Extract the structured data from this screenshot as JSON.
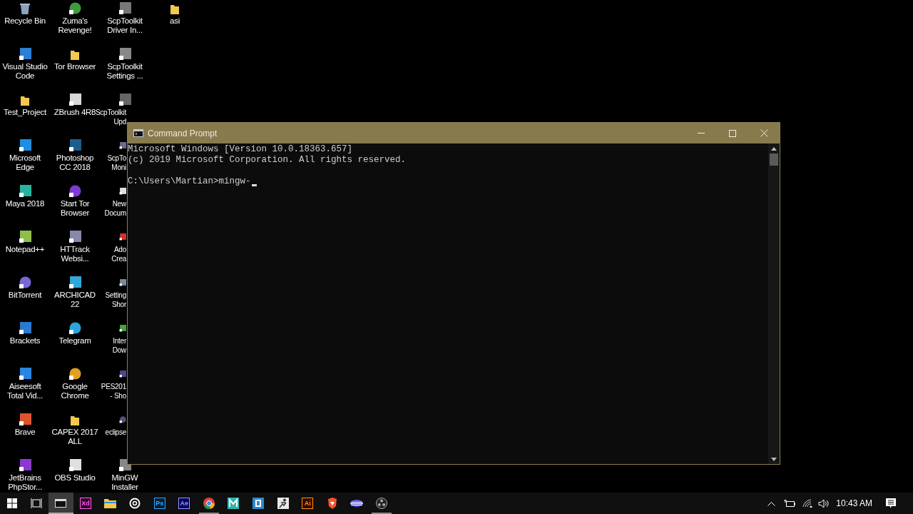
{
  "desktop": {
    "columns": [
      {
        "icons": [
          {
            "label": "Recycle Bin"
          },
          {
            "label": "Visual Studio Code"
          },
          {
            "label": "Test_Project"
          },
          {
            "label": "Microsoft Edge"
          },
          {
            "label": "Maya 2018"
          },
          {
            "label": "Notepad++"
          },
          {
            "label": "BitTorrent"
          },
          {
            "label": "Brackets"
          },
          {
            "label": "Aiseesoft Total Vid..."
          },
          {
            "label": "Brave"
          },
          {
            "label": "JetBrains PhpStor..."
          }
        ]
      },
      {
        "icons": [
          {
            "label": "Zuma's Revenge!"
          },
          {
            "label": "Tor Browser"
          },
          {
            "label": "ZBrush 4R8"
          },
          {
            "label": "Photoshop CC 2018"
          },
          {
            "label": "Start Tor Browser"
          },
          {
            "label": "HTTrack Websi..."
          },
          {
            "label": "ARCHICAD 22"
          },
          {
            "label": "Telegram"
          },
          {
            "label": "Google Chrome"
          },
          {
            "label": "CAPEX 2017 ALL"
          },
          {
            "label": "OBS Studio"
          }
        ]
      },
      {
        "icons": [
          {
            "label": "ScpToolkit Driver In..."
          },
          {
            "label": "ScpToolkit Settings ..."
          },
          {
            "label": "ScpToolkit Upd"
          },
          {
            "label": "ScpTo Moni"
          },
          {
            "label": "New Docum"
          },
          {
            "label": "Ado Crea"
          },
          {
            "label": "Setting Shor"
          },
          {
            "label": "Inter Dow"
          },
          {
            "label": "PES201 - Sho"
          },
          {
            "label": "eclipse"
          },
          {
            "label": "MinGW Installer"
          }
        ]
      },
      {
        "icons": [
          {
            "label": "asi"
          }
        ]
      }
    ]
  },
  "window": {
    "title": "Command Prompt",
    "lines": [
      "Microsoft Windows [Version 10.0.18363.657]",
      "(c) 2019 Microsoft Corporation. All rights reserved.",
      "C:\\Users\\Martian>mingw-"
    ]
  },
  "taskbar": {
    "apps": [
      {
        "running": true,
        "active": true
      },
      {
        "glyph": "Xd",
        "running": false,
        "active": false
      },
      {
        "running": false,
        "active": false
      },
      {
        "running": false,
        "active": false
      },
      {
        "glyph": "Ps",
        "running": false,
        "active": false
      },
      {
        "glyph": "Ae",
        "running": false,
        "active": false
      },
      {
        "running": true,
        "active": false
      },
      {
        "running": false,
        "active": false
      },
      {
        "running": false,
        "active": false
      },
      {
        "running": false,
        "active": false
      },
      {
        "glyph": "Ai",
        "running": false,
        "active": false
      },
      {
        "running": false,
        "active": false
      },
      {
        "running": false,
        "active": false
      },
      {
        "running": true,
        "active": false
      }
    ],
    "clock": "10:43 AM"
  }
}
